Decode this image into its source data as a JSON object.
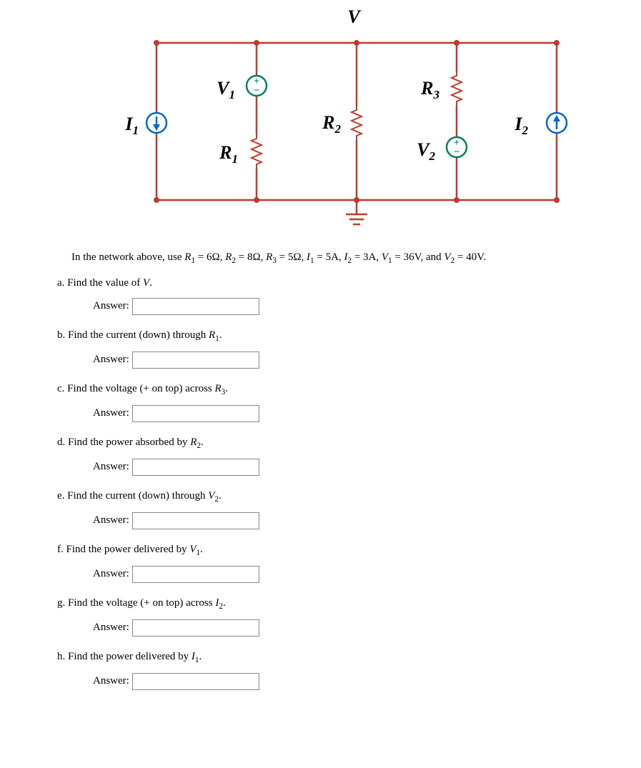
{
  "labels": {
    "V": "V",
    "V1": "V",
    "V1sub": "1",
    "R1": "R",
    "R1sub": "1",
    "R2": "R",
    "R2sub": "2",
    "R3": "R",
    "R3sub": "3",
    "V2": "V",
    "V2sub": "2",
    "I1": "I",
    "I1sub": "1",
    "I2": "I",
    "I2sub": "2"
  },
  "prompt": "In the network above, use R₁ = 6Ω, R₂ = 8Ω, R₃ = 5Ω, I₁ = 5A, I₂ = 3A, V₁ = 36V, and V₂ = 40V.",
  "ansLabel": "Answer:",
  "questions": {
    "a": "a. Find the value of V.",
    "b": "b. Find the current (down) through R₁.",
    "c": "c. Find the voltage (+ on top) across R₃.",
    "d": "d. Find the power absorbed by R₂.",
    "e": "e. Find the current (down) through V₂.",
    "f": "f. Find the power delivered by V₁.",
    "g": "g. Find the voltage (+ on top) across I₂.",
    "h": "h. Find the power delivered by I₁."
  }
}
